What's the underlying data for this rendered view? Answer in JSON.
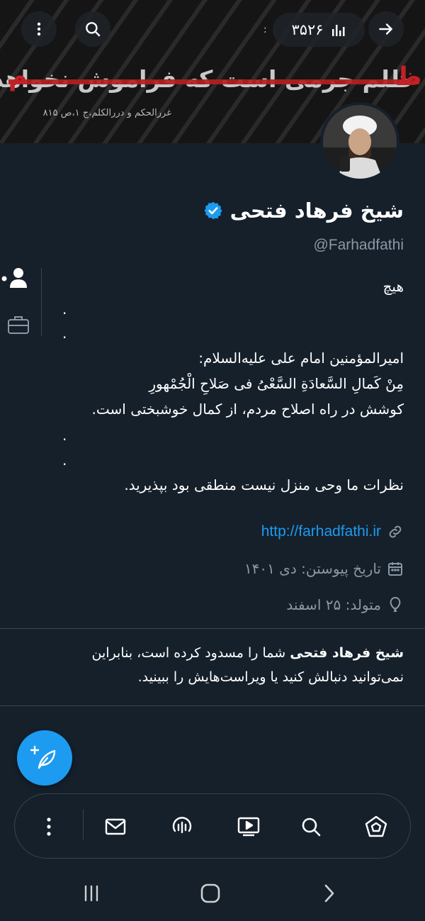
{
  "banner": {
    "quote": "ظلم جرمی است که فراموش نخواهد شد.",
    "red_left": "م",
    "red_right": "ظ",
    "source": "غررالحکم و دررالکلم،ج ۱،ص ۸۱۵",
    "top_fragment": ":"
  },
  "views": {
    "count": "۳۵۲۶",
    "icon": "bar-chart-icon"
  },
  "profile": {
    "display_name": "شیخ فرهاد فتحی",
    "handle": "@Farhadfathi",
    "verified_color": "#1d9bf0"
  },
  "bio": {
    "line1": "هیچ",
    "dot1": ".",
    "dot2": ".",
    "line2": "امیرالمؤمنین امام علی علیه‌السلام:",
    "line3": "مِنْ کَمالِ السَّعادَةِ السَّعْیُ فی صَلاحِ الْجُمْهورِ",
    "line4": "کوشش در راه اصلاح مردم، از کمال خوشبختی است.",
    "dot3": ".",
    "dot4": ".",
    "line5": "نظرات ما وحی منزل نیست منطقی بود بپذیرید."
  },
  "meta": {
    "link": "http://farhadfathi.ir",
    "joined": "تاریخ پیوستن: دی ۱۴۰۱",
    "birthday": "متولد: ۲۵ اسفند"
  },
  "blocked": {
    "name": "شیخ فرهاد فتحی",
    "line1_rest": " شما را مسدود کرده است، بنابراین",
    "line2": "نمی‌توانید دنبالش کنید یا ویراست‌هایش را ببینید."
  },
  "colors": {
    "background": "#15202b",
    "accent": "#1d9bf0",
    "secondary_text": "#8b98a5",
    "divider": "#38444d",
    "banner_red": "#c22126"
  }
}
